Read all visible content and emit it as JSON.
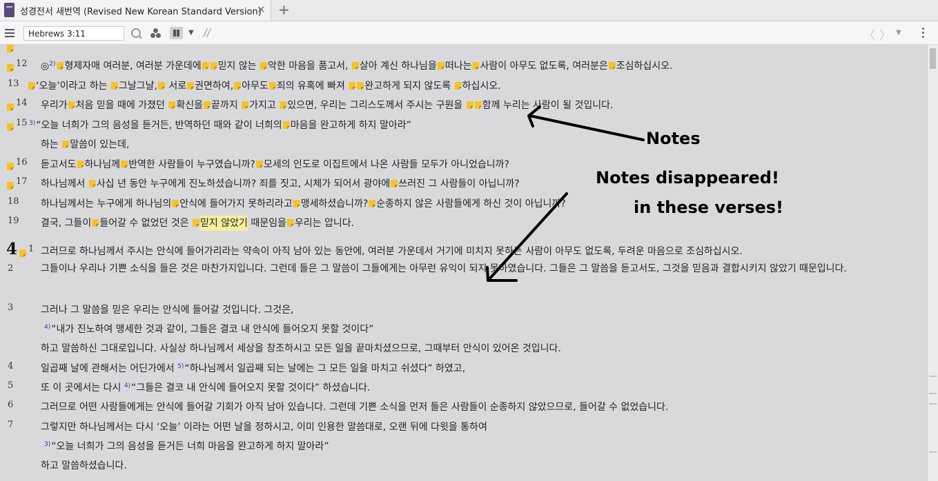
{
  "tab": {
    "title": "성경전서 새번역 (Revised New Korean Standard Version)",
    "close_glyph": "✕",
    "new_glyph": "+"
  },
  "toolbar": {
    "reference_value": "Hebrews 3:11",
    "parallel_glyph": "//",
    "prev_glyph": "〈",
    "next_glyph": "〉",
    "dropdown_glyph": "▼"
  },
  "verses": {
    "v3_12": {
      "num": "12",
      "fn": "2)",
      "t1": "형제자매 여러분, 여러분 가운데에",
      "t2": "믿지 않는",
      "t3": "악한 마음을 품고서,",
      "t4": "살아 계신 하나님을",
      "t5": "떠나는",
      "t6": "사람이 아무도 없도록, 여러분은",
      "t7": "조심하십시오.",
      "lead": "◎"
    },
    "v3_13": {
      "num": "13",
      "t0": "‘",
      "t1": "‘오늘’이라고 하는",
      "t2": "그날그날,",
      "t3": "서로",
      "t4": "권면하여,",
      "t5": "아무도",
      "t6": "죄의 유혹에 빠져",
      "t7": "완고하게 되지 않도록",
      "t8": "하십시오."
    },
    "v3_14": {
      "num": "14",
      "t1": "우리가",
      "t2": "처음 믿을 때에 가졌던",
      "t3": "확신을",
      "t4": "끝까지",
      "t5": "가지고",
      "t6": "있으면, 우리는 그리스도께서 주시는 구원을",
      "t7": "함께 누리는 사람이 될 것입니다."
    },
    "v3_15": {
      "num": "15",
      "fn": "3)",
      "t1": "“오늘 너희가 그의 음성을 듣거든, 반역하던 때와 같이 너희의",
      "t2": "마음을 완고하게 하지 말아라”",
      "cont1": "하는",
      "cont2": "말씀이 있는데,"
    },
    "v3_16": {
      "num": "16",
      "t1": "듣고서도",
      "t2": "하나님께",
      "t3": "반역한 사람들이 누구였습니까?",
      "t4": "모세의 인도로 이집트에서 나온 사람들 모두가 아니었습니까?"
    },
    "v3_17": {
      "num": "17",
      "t1": "하나님께서",
      "t2": "사십 년 동안 누구에게 진노하셨습니까? 죄를 짓고, 시체가 되어서 광야에",
      "t3": "쓰러진 그 사람들이 아닙니까?"
    },
    "v3_18": {
      "num": "18",
      "t1": "하나님께서는 누구에게 하나님의",
      "t2": "안식에 들어가지 못하리라고",
      "t3": "맹세하셨습니까?",
      "t4": "순종하지 않은 사람들에게 하신 것이 아닙니까?"
    },
    "v3_19": {
      "num": "19",
      "t1": "결국, 그들이",
      "t2": "들어갈 수 없었던 것은",
      "t3": "믿지 않았기",
      "t4": "때문임을",
      "t5": "우리는 압니다."
    },
    "v4_1": {
      "chapter": "4",
      "num": "1",
      "t1": "그러므로 하나님께서 주시는 안식에 들어가리라는 약속이 아직 남아 있는 동안에, 여러분 가운데서 거기에 미치지 못하는 사람이 아무도 없도록, 두려운 마음으로 조심하십시오."
    },
    "v4_2": {
      "num": "2",
      "t1": "그들이나 우리나 기쁜 소식을 들은 것은 마찬가지입니다. 그런데 들은 그 말씀이 그들에게는 아무런 유익이 되지 못하였습니다. 그들은 그 말씀을 듣고서도, 그것을 믿음과 결합시키지 않았기 때문입니다."
    },
    "v4_3": {
      "num": "3",
      "t1": "그러나 그 말씀을 믿은 우리는 안식에 들어갈 것입니다. 그것은,",
      "fn": "4)",
      "t2": "“내가 진노하여 맹세한 것과 같이, 그들은 결코 내 안식에 들어오지 못할 것이다”",
      "t3": "하고 말씀하신 그대로입니다. 사실상 하나님께서 세상을 창조하시고 모든 일을 끝마치셨으므로, 그때부터 안식이 있어온 것입니다."
    },
    "v4_4": {
      "num": "4",
      "t1": "일곱째 날에 관해서는 어딘가에서",
      "fn": "5)",
      "t2": "“하나님께서 일곱째 되는 날에는 그 모든 일을 마치고 쉬셨다” 하였고,"
    },
    "v4_5": {
      "num": "5",
      "t1": "또 이 곳에서는 다시",
      "fn": "4)",
      "t2": "“그들은 결코 내 안식에 들어오지 못할 것이다” 하셨습니다."
    },
    "v4_6": {
      "num": "6",
      "t1": "그러므로 어떤 사람들에게는 안식에 들어갈 기회가 아직 남아 있습니다. 그런데 기쁜 소식을 먼저 들은 사람들이 순종하지 않았으므로, 들어갈 수 없었습니다."
    },
    "v4_7": {
      "num": "7",
      "t1": "그렇지만 하나님께서는 다시 ‘오늘’ 이라는 어떤 날을 정하시고, 이미 인용한 말씀대로, 오랜 뒤에 다윗을 통하여",
      "fn": "3)",
      "t2": "“오늘 너희가 그의 음성을 듣거든 너희 마음을 완고하게 하지 말아라”",
      "t3": "하고 말씀하셨습니다."
    }
  },
  "annotations": {
    "notes": "Notes",
    "disappeared": "Notes disappeared!",
    "in_verses": "in these verses!"
  },
  "colors": {
    "background": "#d9d9dc",
    "note_icon": "#f4c22a",
    "highlight": "#f3ef9e",
    "footnote": "#2a3ea8"
  }
}
